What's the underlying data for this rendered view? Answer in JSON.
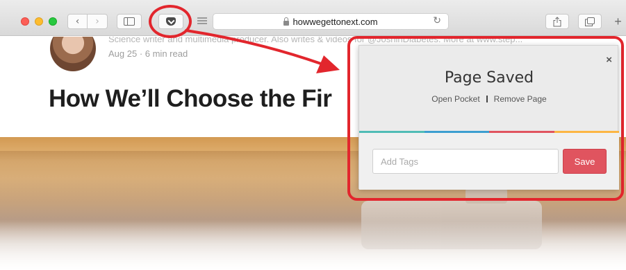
{
  "browser": {
    "url": "howwegettonext.com",
    "icons": {
      "back": "chevron-left-icon",
      "forward": "chevron-right-icon",
      "sidebar": "sidebar-icon",
      "pocket": "pocket-icon",
      "reader": "reader-icon",
      "lock": "lock-icon",
      "reload": "reload-icon",
      "share": "share-icon",
      "tabs": "tabs-icon",
      "new_tab": "plus-icon"
    }
  },
  "article": {
    "author_bio": "Science writer and multimedia producer. Also writes & videos for @JoshinDiabetes. More at www.step...",
    "meta": "Aug 25 · 6 min read",
    "headline": "How We’ll Choose the Fir"
  },
  "pocket_popup": {
    "title": "Page Saved",
    "open_link": "Open Pocket",
    "remove_link": "Remove Page",
    "close": "×",
    "tags_placeholder": "Add Tags",
    "save_label": "Save",
    "stripe_colors": [
      "#50bcb6",
      "#3c9ed0",
      "#e0545f",
      "#fcb643"
    ]
  },
  "annotation_color": "#e2262d"
}
